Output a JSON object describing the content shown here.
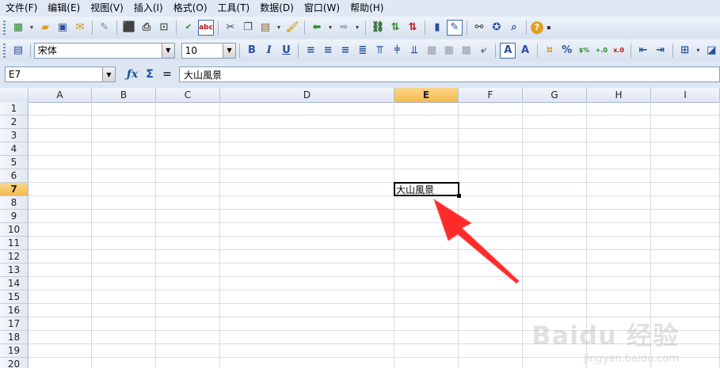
{
  "menu": [
    "文件(F)",
    "编辑(E)",
    "视图(V)",
    "插入(I)",
    "格式(O)",
    "工具(T)",
    "数据(D)",
    "窗口(W)",
    "帮助(H)"
  ],
  "toolbar2": {
    "font_name": "宋体",
    "font_size": "10",
    "bold_label": "B",
    "italic_label": "I",
    "underline_label": "U"
  },
  "formula_bar": {
    "name_box": "E7",
    "formula_value": "大山風景"
  },
  "sheet": {
    "columns": [
      "A",
      "B",
      "C",
      "D",
      "E",
      "F",
      "G",
      "H",
      "I"
    ],
    "rows": [
      "1",
      "2",
      "3",
      "4",
      "5",
      "6",
      "7",
      "8",
      "9",
      "10",
      "11",
      "12",
      "13",
      "14",
      "15",
      "16",
      "17",
      "18",
      "19",
      "20"
    ],
    "selected_column": "E",
    "selected_row": "7",
    "cell_E7": "大山風景"
  },
  "watermark": {
    "brand": "Baidu 经验",
    "url": "jingyan.baidu.com"
  },
  "colors": {
    "selection_header": "#f5b84c",
    "arrow": "#ff2020",
    "chrome": "#dde6f2"
  }
}
